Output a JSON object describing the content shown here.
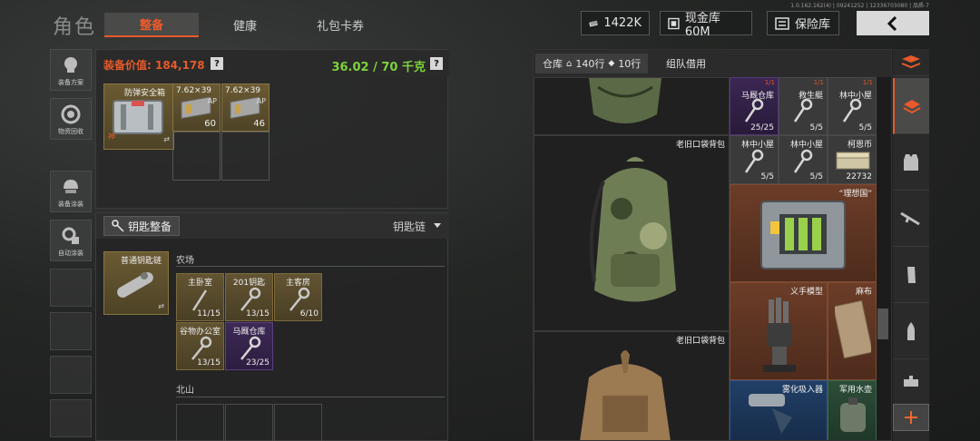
{
  "header": {
    "title": "角色",
    "tabs": [
      {
        "label": "整备",
        "active": true
      },
      {
        "label": "健康",
        "active": false
      },
      {
        "label": "礼包卡券",
        "active": false
      }
    ],
    "version": "1.0.162.162(4) | 09241252 | 12336703080 | 品质-7",
    "currency_amount": "1422K",
    "cash_store_label": "现金库 60M",
    "insurance_label": "保险库",
    "accent_color": "#e8592b"
  },
  "left_bar": [
    {
      "label": "装备方案",
      "icon": "gear-loadout-icon"
    },
    {
      "label": "物资回收",
      "icon": "recycle-icon"
    },
    {
      "label": "装备涂装",
      "icon": "helmet-paint-icon"
    },
    {
      "label": "自动涂装",
      "icon": "auto-paint-icon"
    }
  ],
  "equipment": {
    "value_label": "装备价值: 184,178",
    "weight_label": "36.02 / 70 千克",
    "items": [
      {
        "name": "防弹安全箱",
        "sub": "神"
      },
      {
        "name": "7.62×39",
        "tag": "AP",
        "count": "60"
      },
      {
        "name": "7.62×39",
        "tag": "AP",
        "count": "46"
      }
    ]
  },
  "keys": {
    "button_label": "钥匙整备",
    "chain_label": "钥匙链",
    "chain_item": "普通钥匙链",
    "area1": "农场",
    "area1_keys": [
      {
        "name": "主卧室",
        "count": "11/15"
      },
      {
        "name": "201钥匙",
        "count": "13/15"
      },
      {
        "name": "主客房",
        "count": "6/10"
      },
      {
        "name": "谷物办公室",
        "count": "13/15"
      },
      {
        "name": "马厩仓库",
        "count": "23/25",
        "rarity": "purple"
      }
    ],
    "area2": "北山"
  },
  "storage": {
    "tab_label": "仓库",
    "rows_label": "140行",
    "rows2_label": "10行",
    "team_tab": "组队借用",
    "items": {
      "backpack1": "老旧口袋背包",
      "backpack2": "老旧口袋背包",
      "stable_key": {
        "name": "马厩仓库",
        "count": "25/25"
      },
      "lifeboat_key": {
        "name": "救生艇",
        "count": "5/5"
      },
      "cabin_key1": {
        "name": "林中小屋",
        "count": "5/5"
      },
      "cabin_key2": {
        "name": "林中小屋",
        "count": "5/5"
      },
      "cabin_key3": {
        "name": "林中小屋",
        "count": "5/5"
      },
      "kabul_coin": {
        "name": "柯恩币",
        "count": "22732"
      },
      "ideal_case": "“理想国”",
      "prosthetic": "义手模型",
      "linen": "麻布",
      "inhaler": "雾化吸入器",
      "canteen": "军用水壶",
      "fraction_top": "1/1"
    }
  }
}
